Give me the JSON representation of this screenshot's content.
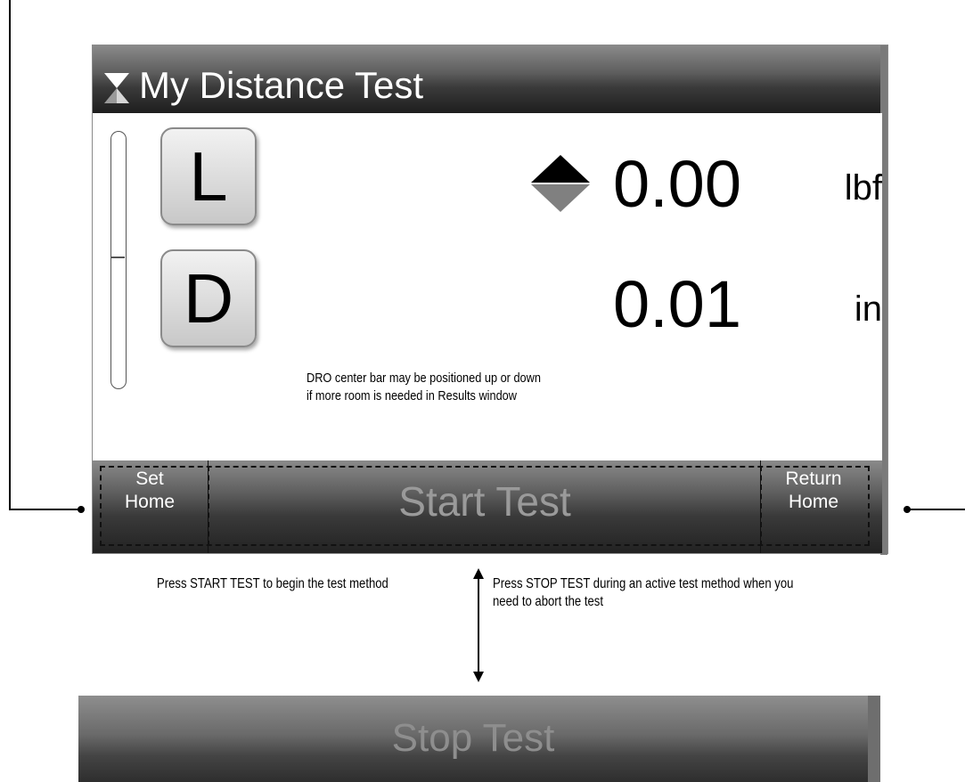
{
  "screen": {
    "title": "My Distance Test",
    "title_icon": "hourglass-icon",
    "buttons": {
      "load_key": "L",
      "distance_key": "D"
    },
    "readouts": {
      "load_value": "0.00",
      "load_unit": "lbf",
      "distance_value": "0.01",
      "distance_unit": "in",
      "direction_icon": "up-down-arrow-icon"
    },
    "note_lines": [
      "DRO center bar may be positioned up or down",
      "if more room is needed in Results window"
    ],
    "bottom_bar": {
      "set_home_line1": "Set",
      "set_home_line2": "Home",
      "start_test": "Start Test",
      "return_home_line1": "Return",
      "return_home_line2": "Home"
    }
  },
  "captions": {
    "start": "Press START TEST to begin the test method",
    "stop_line1": "Press STOP TEST during an active test method when you",
    "stop_line2": "need to abort the test"
  },
  "stop_bar": {
    "label": "Stop Test"
  },
  "colors": {
    "bar_dark": "#1e1e1e",
    "bar_light": "#8a8a8a",
    "disabled_text": "#9a9a9a",
    "up_arrow": "#000000",
    "down_arrow": "#808080"
  }
}
